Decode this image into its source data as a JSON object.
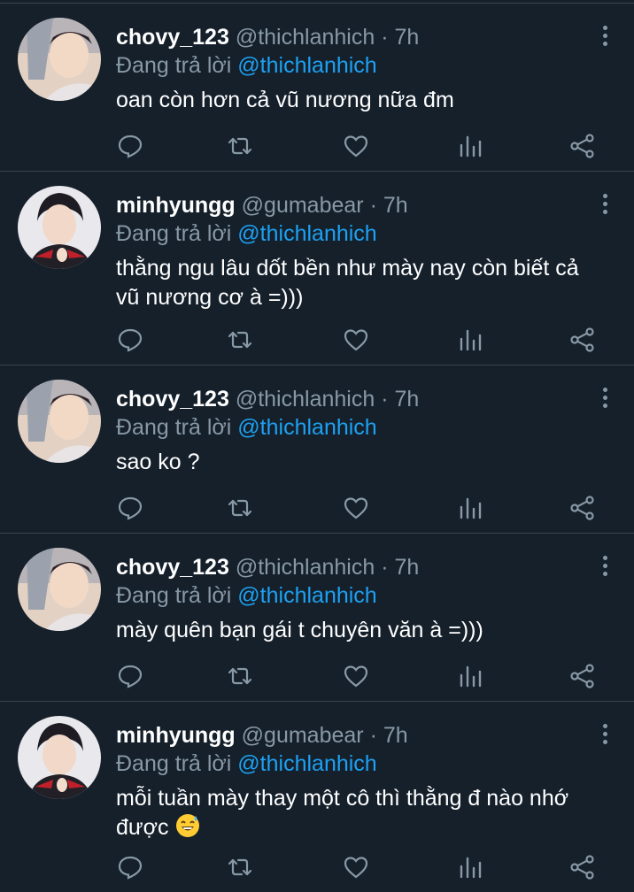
{
  "reply_prefix": "Đang trả lời",
  "tweets": [
    {
      "name": "chovy_123",
      "handle": "@thichlanhich",
      "dot": "·",
      "time": "7h",
      "reply_to": "@thichlanhich",
      "text": "oan còn hơn cả vũ nương nữa đm",
      "avatar": "avatar-chovy"
    },
    {
      "name": "minhyungg",
      "handle": "@gumabear",
      "dot": "·",
      "time": "7h",
      "reply_to": "@thichlanhich",
      "text": "thằng ngu lâu dốt bền như mày nay còn biết cả vũ nương cơ à =)))",
      "avatar": "avatar-minhyungg"
    },
    {
      "name": "chovy_123",
      "handle": "@thichlanhich",
      "dot": "·",
      "time": "7h",
      "reply_to": "@thichlanhich",
      "text": "sao ko ?",
      "avatar": "avatar-chovy"
    },
    {
      "name": "chovy_123",
      "handle": "@thichlanhich",
      "dot": "·",
      "time": "7h",
      "reply_to": "@thichlanhich",
      "text": "mày quên bạn gái t chuyên văn à =)))",
      "avatar": "avatar-chovy"
    },
    {
      "name": "minhyungg",
      "handle": "@gumabear",
      "dot": "·",
      "time": "7h",
      "reply_to": "@thichlanhich",
      "text": "mỗi tuần mày thay một cô thì thằng đ nào nhớ được",
      "text_emoji": "sweat-smile-emoji",
      "avatar": "avatar-minhyungg"
    }
  ],
  "colors": {
    "background": "#15202b",
    "divider": "#38444d",
    "secondary_text": "#8899a6",
    "mention": "#1da1f2"
  },
  "icons": [
    "reply-icon",
    "retweet-icon",
    "like-icon",
    "analytics-icon",
    "share-icon",
    "more-options-icon"
  ]
}
